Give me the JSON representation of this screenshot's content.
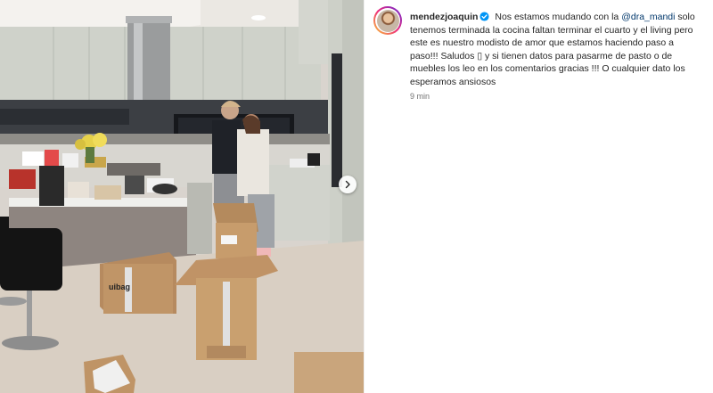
{
  "post": {
    "username": "mendezjoaquin",
    "verified_icon": "verified-badge-icon",
    "caption_before_mention": "Nos estamos mudando con la",
    "mention": "@dra_mandi",
    "caption_after_mention": "solo tenemos terminada la cocina faltan terminar el cuarto y el living pero este es nuestro modisto de amor que estamos haciendo paso a paso!!! Saludos",
    "caption_glyph": "▯",
    "caption_end": "y si tienen datos para pasarme de pasto o de muebles los leo en los comentarios gracias !!! O cualquier dato los esperamos ansiosos",
    "time": "9 min"
  },
  "media": {
    "next_icon": "chevron-right-icon",
    "box_brand": "uibag"
  },
  "colors": {
    "text": "#262626",
    "mention": "#00376b",
    "muted": "#737373",
    "verified": "#0095f6"
  }
}
